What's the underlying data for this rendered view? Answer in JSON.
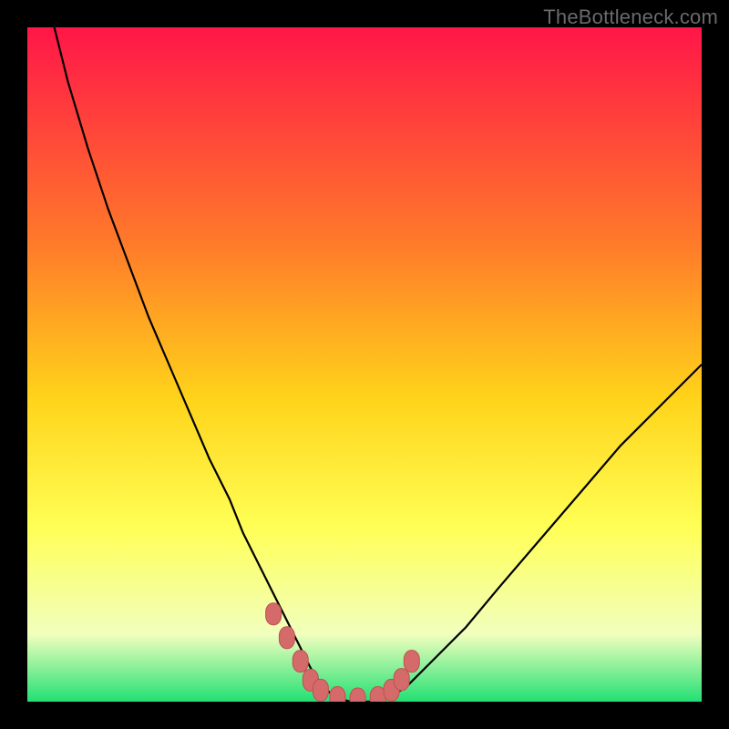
{
  "watermark": "TheBottleneck.com",
  "colors": {
    "bg": "#000000",
    "grad_top": "#ff1648",
    "grad_mid1": "#ff7a2a",
    "grad_mid2": "#ffd31a",
    "grad_mid3": "#ffff55",
    "grad_mid4": "#f1ffbe",
    "grad_bottom": "#22e074",
    "curve": "#000000",
    "marker_fill": "#d46a6a",
    "marker_stroke": "#c05050"
  },
  "chart_data": {
    "type": "line",
    "title": "",
    "xlabel": "",
    "ylabel": "",
    "xlim": [
      0,
      100
    ],
    "ylim": [
      0,
      100
    ],
    "series": [
      {
        "name": "bottleneck-curve",
        "x": [
          4,
          6,
          9,
          12,
          15,
          18,
          21,
          24,
          27,
          30,
          32,
          34,
          36,
          38,
          40,
          42,
          44,
          46,
          48,
          52,
          56,
          60,
          65,
          70,
          76,
          82,
          88,
          94,
          100
        ],
        "y": [
          100,
          92,
          82,
          73,
          65,
          57,
          50,
          43,
          36,
          30,
          25,
          21,
          17,
          13,
          9,
          5,
          2,
          0.5,
          0,
          0,
          2,
          6,
          11,
          17,
          24,
          31,
          38,
          44,
          50
        ]
      }
    ],
    "markers": {
      "name": "highlight-points",
      "x": [
        36.5,
        38.5,
        40.5,
        42,
        43.5,
        46,
        49,
        52,
        54,
        55.5,
        57
      ],
      "y": [
        13,
        9.5,
        6,
        3.2,
        1.7,
        0.6,
        0.4,
        0.6,
        1.7,
        3.3,
        6
      ]
    }
  }
}
